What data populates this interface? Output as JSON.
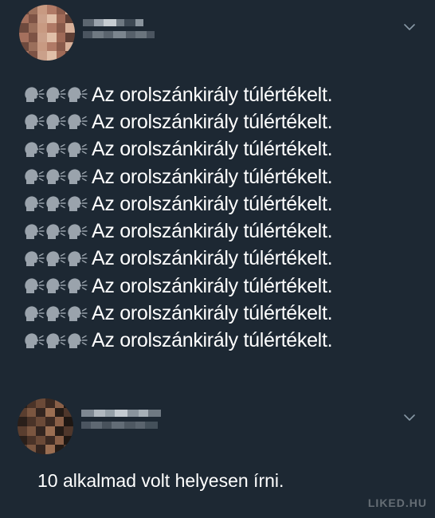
{
  "tweets": [
    {
      "author_hidden": true,
      "lines": [
        "Az orolszánkirály túlértékelt.",
        "Az orolszánkirály túlértékelt.",
        "Az orolszánkirály túlértékelt.",
        "Az orolszánkirály túlértékelt.",
        "Az orolszánkirály túlértékelt.",
        "Az orolszánkirály túlértékelt.",
        "Az orolszánkirály túlértékelt.",
        "Az orolszánkirály túlértékelt.",
        "Az orolszánkirály túlértékelt.",
        "Az orolszánkirály túlértékelt."
      ],
      "line_prefix_icon": "speaking-head-icon"
    },
    {
      "author_hidden": true,
      "text": "10 alkalmad volt helyesen írni."
    }
  ],
  "icons": {
    "menu": "chevron-down-icon",
    "prefix": "speaking-head-icon"
  },
  "watermark": "LIKED.HU",
  "colors": {
    "background": "#1d2833",
    "text": "#ffffff",
    "chevron": "#8899a6",
    "watermark": "#ffffff"
  }
}
